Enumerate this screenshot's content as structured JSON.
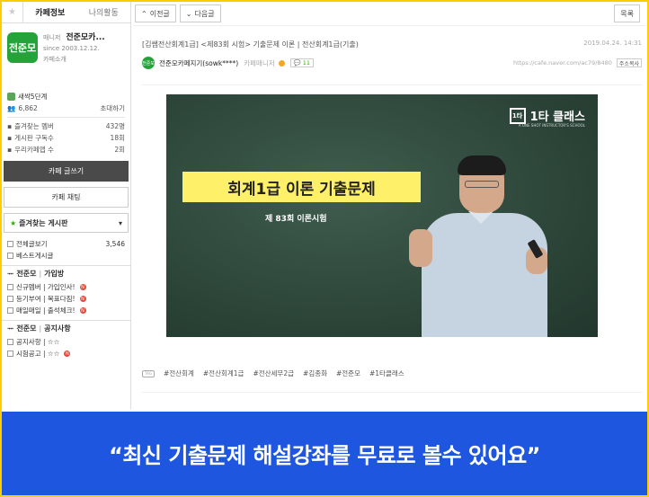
{
  "sidebar": {
    "tabs": [
      "카페정보",
      "나의활동"
    ],
    "cafe": {
      "manager_label": "매니저",
      "name": "전준모카...",
      "since": "since 2003.12.12.",
      "intro": "카페소개",
      "logo_text": "전준모"
    },
    "level": "새싹5단계",
    "members": {
      "count": "6,862",
      "invite": "초대하기"
    },
    "stats": [
      {
        "label": "즐겨찾는 멤버",
        "value": "432명"
      },
      {
        "label": "게시판 구독수",
        "value": "18회"
      },
      {
        "label": "우리카페앱 수",
        "value": "2회"
      }
    ],
    "write_button": "카페 글쓰기",
    "chat_button": "카페 채팅",
    "favorites_label": "즐겨찾는 게시판",
    "boards": [
      {
        "label": "전체글보기",
        "count": "3,546"
      },
      {
        "label": "베스트게시글",
        "count": ""
      }
    ],
    "groups": [
      {
        "prefix": "전준모",
        "title": "가입방",
        "items": [
          {
            "label": "신규멤버 | 가입인사!",
            "new": true
          },
          {
            "label": "등기부여 | 목표다짐!",
            "new": true
          },
          {
            "label": "매일매일 | 출석체크!",
            "new": true
          }
        ]
      },
      {
        "prefix": "전준모",
        "title": "공지사항",
        "items": [
          {
            "label": "공지사항 | ☆☆",
            "new": false
          },
          {
            "label": "시험공고 | ☆☆",
            "new": true
          }
        ]
      }
    ]
  },
  "toolbar": {
    "prev": "이전글",
    "next": "다음글",
    "list": "목록"
  },
  "post": {
    "title": "[김쌤전산회계1급] <제83회 시험> 기출문제 이론 | 전산회계1급(기출)",
    "date": "2019.04.24. 14:31",
    "author": "전준모카페지기(sowk****)",
    "role": "카페매니저",
    "comments": "11",
    "url": "https://cafe.naver.com/ac79/8480",
    "copy": "주소복사",
    "avatar_text": "전준모",
    "tag_icon": "TAG",
    "tags": [
      "#전산회계",
      "#전산회계1급",
      "#전산세무2급",
      "#김종화",
      "#전준모",
      "#1타클래스"
    ]
  },
  "video": {
    "brand": "1타 클래스",
    "brand_mark": "1타",
    "brand_sub": "A ONE SHOT INSTRUCTOR'S SCHOOL",
    "headline": "회계1급 이론 기출문제",
    "episode": "제 83회 이론시험"
  },
  "banner": {
    "text": "“최신 기출문제 해설강좌를 무료로 볼수 있어요”"
  }
}
